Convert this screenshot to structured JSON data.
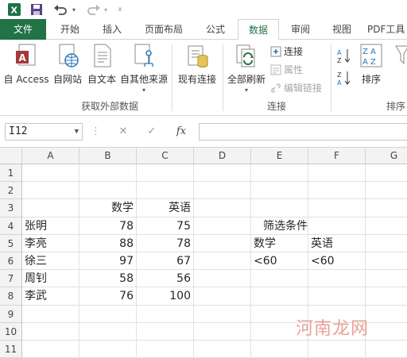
{
  "qat": {
    "icons": [
      "excel-icon",
      "save-icon",
      "undo-icon",
      "redo-icon",
      "customize-icon"
    ]
  },
  "tabs": [
    "文件",
    "开始",
    "插入",
    "页面布局",
    "公式",
    "数据",
    "审阅",
    "视图",
    "PDF工具"
  ],
  "active_tab": "数据",
  "ribbon": {
    "buttons": {
      "access": "自 Access",
      "web": "自网站",
      "text": "自文本",
      "other": "自其他来源",
      "existing": "现有连接",
      "refresh_all": "全部刷新",
      "sort": "排序"
    },
    "connections": {
      "connect": "连接",
      "properties": "属性",
      "edit_links": "编辑链接"
    },
    "groups": {
      "external": "获取外部数据",
      "connections": "连接",
      "sort_filter": "排序"
    }
  },
  "formula_bar": {
    "name_box": "I12",
    "fx": "fx",
    "cancel": "✕",
    "enter": "✓",
    "formula": ""
  },
  "columns": [
    "A",
    "B",
    "C",
    "D",
    "E",
    "F",
    "G"
  ],
  "rows": [
    "1",
    "2",
    "3",
    "4",
    "5",
    "6",
    "7",
    "8",
    "9",
    "10",
    "11"
  ],
  "sheet": {
    "B3": "数学",
    "C3": "英语",
    "A4": "张明",
    "B4": "78",
    "C4": "75",
    "A5": "李亮",
    "B5": "88",
    "C5": "78",
    "A6": "徐三",
    "B6": "97",
    "C6": "67",
    "A7": "周钊",
    "B7": "58",
    "C7": "56",
    "A8": "李武",
    "B8": "76",
    "C8": "100",
    "E4": "筛选条件",
    "E5": "数学",
    "F5": "英语",
    "E6": "<60",
    "F6": "<60"
  },
  "watermark": "河南龙网"
}
